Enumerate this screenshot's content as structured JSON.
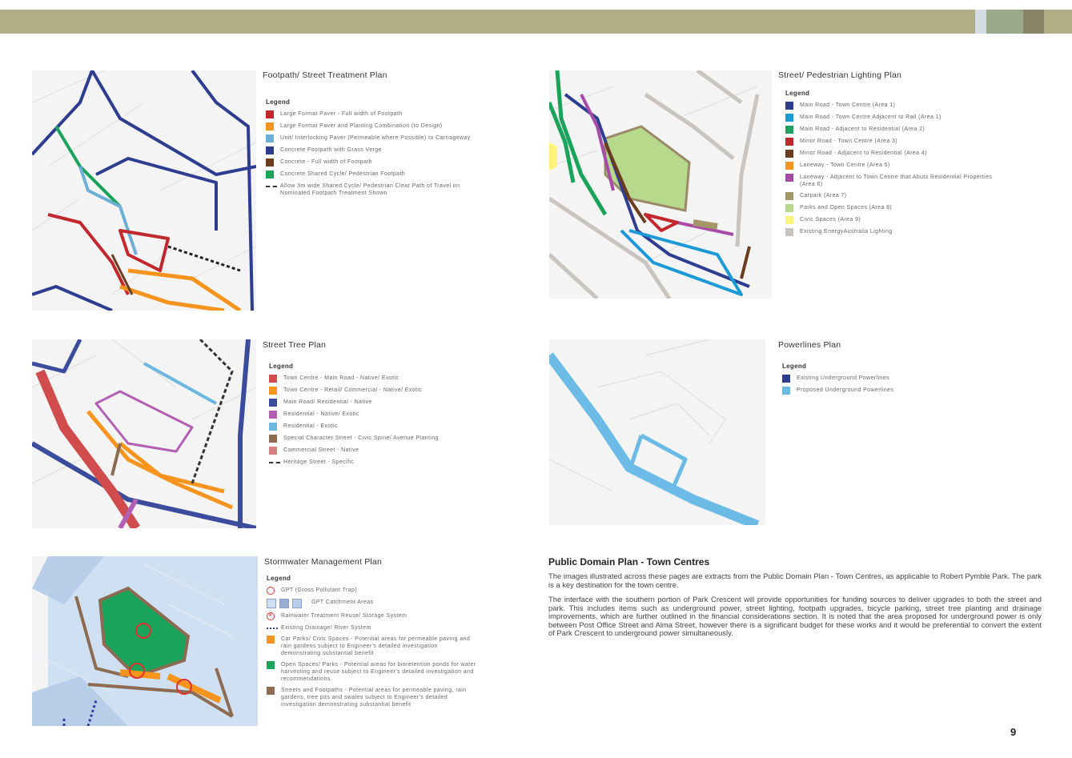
{
  "colors": {
    "band": "#b2ad84"
  },
  "footpath": {
    "title": "Footpath/ Street Treatment Plan",
    "legend_heading": "Legend",
    "items": [
      {
        "label": "Large Format Paver - Full width of Footpath",
        "color": "#c1272d"
      },
      {
        "label": "Large Format Paver and Planting Combination (to Design)",
        "color": "#f7941d"
      },
      {
        "label": "Unit/ Interlocking Paver (Permeable where Possible) to Carriageway",
        "color": "#6baed6"
      },
      {
        "label": "Concrete Footpath with Grass Verge",
        "color": "#2e3d8f"
      },
      {
        "label": "Concrete - Full width of Footpath",
        "color": "#6b3d1e"
      },
      {
        "label": "Concrete Shared Cycle/ Pedestrian Footpath",
        "color": "#1aa35a"
      },
      {
        "label": "Allow 3m wide Shared Cycle/ Pedestrian Clear Path of Travel on Nominated Footpath Treatment Shown",
        "color": "dash"
      }
    ]
  },
  "lighting": {
    "title": "Street/ Pedestrian Lighting Plan",
    "legend_heading": "Legend",
    "items": [
      {
        "label": "Main Road - Town Centre (Area 1)",
        "color": "#2e3d8f"
      },
      {
        "label": "Main Road - Town Centre Adjacent to Rail (Area 1)",
        "color": "#1b9ad6"
      },
      {
        "label": "Main Road - Adjacent to Residential (Area 2)",
        "color": "#1aa35a"
      },
      {
        "label": "Minor Road - Town Centre (Area 3)",
        "color": "#c1272d"
      },
      {
        "label": "Minor Road - Adjacent to Residential (Area 4)",
        "color": "#6b3d1e"
      },
      {
        "label": "Laneway - Town Centre (Area 5)",
        "color": "#f7941d"
      },
      {
        "label": "Laneway - Adjacent to Town Centre that Abuts Residential Properties (Area 6)",
        "color": "#a64ca6"
      },
      {
        "label": "Carpark (Area 7)",
        "color": "#a39668"
      },
      {
        "label": "Parks and Open Spaces (Area 8)",
        "color": "#b7d98c"
      },
      {
        "label": "Civic Spaces (Area 9)",
        "color": "#fff27a"
      },
      {
        "label": "Existing EnergyAustralia Lighting",
        "color": "#c8c4bf"
      }
    ]
  },
  "trees": {
    "title": "Street Tree Plan",
    "legend_heading": "Legend",
    "items": [
      {
        "label": "Town Centre - Main Road - Native/ Exotic",
        "color": "#d14d4d"
      },
      {
        "label": "Town Centre - Retail/ Commercial - Native/ Exotic",
        "color": "#f7941d"
      },
      {
        "label": "Main Road/ Residential - Native",
        "color": "#3b4c9c"
      },
      {
        "label": "Residential - Native/ Exotic",
        "color": "#b35fb3"
      },
      {
        "label": "Residential - Exotic",
        "color": "#6bb7e0"
      },
      {
        "label": "Special Character Street - Civic Spine/ Avenue Planting",
        "color": "#8c6b52"
      },
      {
        "label": "Commercial Street - Native",
        "color": "#d98080"
      },
      {
        "label": "Heritage Street - Specific",
        "color": "dash"
      }
    ]
  },
  "powerlines": {
    "title": "Powerlines Plan",
    "legend_heading": "Legend",
    "items": [
      {
        "label": "Existing Underground Powerlines",
        "color": "#2e3d8f"
      },
      {
        "label": "Proposed Underground Powerlines",
        "color": "#6bbbe6"
      }
    ]
  },
  "stormwater": {
    "title": "Stormwater Management Plan",
    "legend_heading": "Legend",
    "items": [
      {
        "label": "GPT (Gross Pollutant Trap)",
        "kind": "circle"
      },
      {
        "label": "GPT Catchment Areas",
        "kind": "squares"
      },
      {
        "label": "Rainwater Treatment Reuse/ Storage System",
        "kind": "circlex"
      },
      {
        "label": "Existing Drainage/ River System",
        "kind": "dots"
      },
      {
        "label": "Car Parks/ Civic Spaces - Potential areas for permeable paving and rain gardens subject to Engineer's detailed investigation demonstrating substantial benefit",
        "color": "#f7941d"
      },
      {
        "label": "Open Spaces/ Parks - Potential areas for bioretention ponds for water harvesting and reuse subject to Engineer's detailed investigation and recommendations.",
        "color": "#1aa35a"
      },
      {
        "label": "Streets and Footpaths - Potential areas for permeable paving, rain gardens, tree pits and swales subject to Engineer's detailed investigation demonstrating substantial benefit",
        "color": "#8c6b52"
      }
    ]
  },
  "text": {
    "heading": "Public Domain Plan - Town Centres",
    "para1": "The images illustrated across these pages are extracts from the Public Domain Plan - Town Centres, as applicable to Robert Pymble Park. The park is a key destination for the town centre.",
    "para2": "The interface with the southern portion of Park Crescent will provide opportunities for funding sources to deliver upgrades to both the street and park. This includes items such as underground power, street lighting, footpath upgrades, bicycle parking, street tree planting and drainage improvements, which are further outlined in the financial considerations section. It is noted that the area proposed for underground power is only between Post Office Street and Alma Street, however there is a significant budget for these works and it would be preferential to convert the extent of Park Crescent to underground power simultaneously."
  },
  "page_number": "9"
}
